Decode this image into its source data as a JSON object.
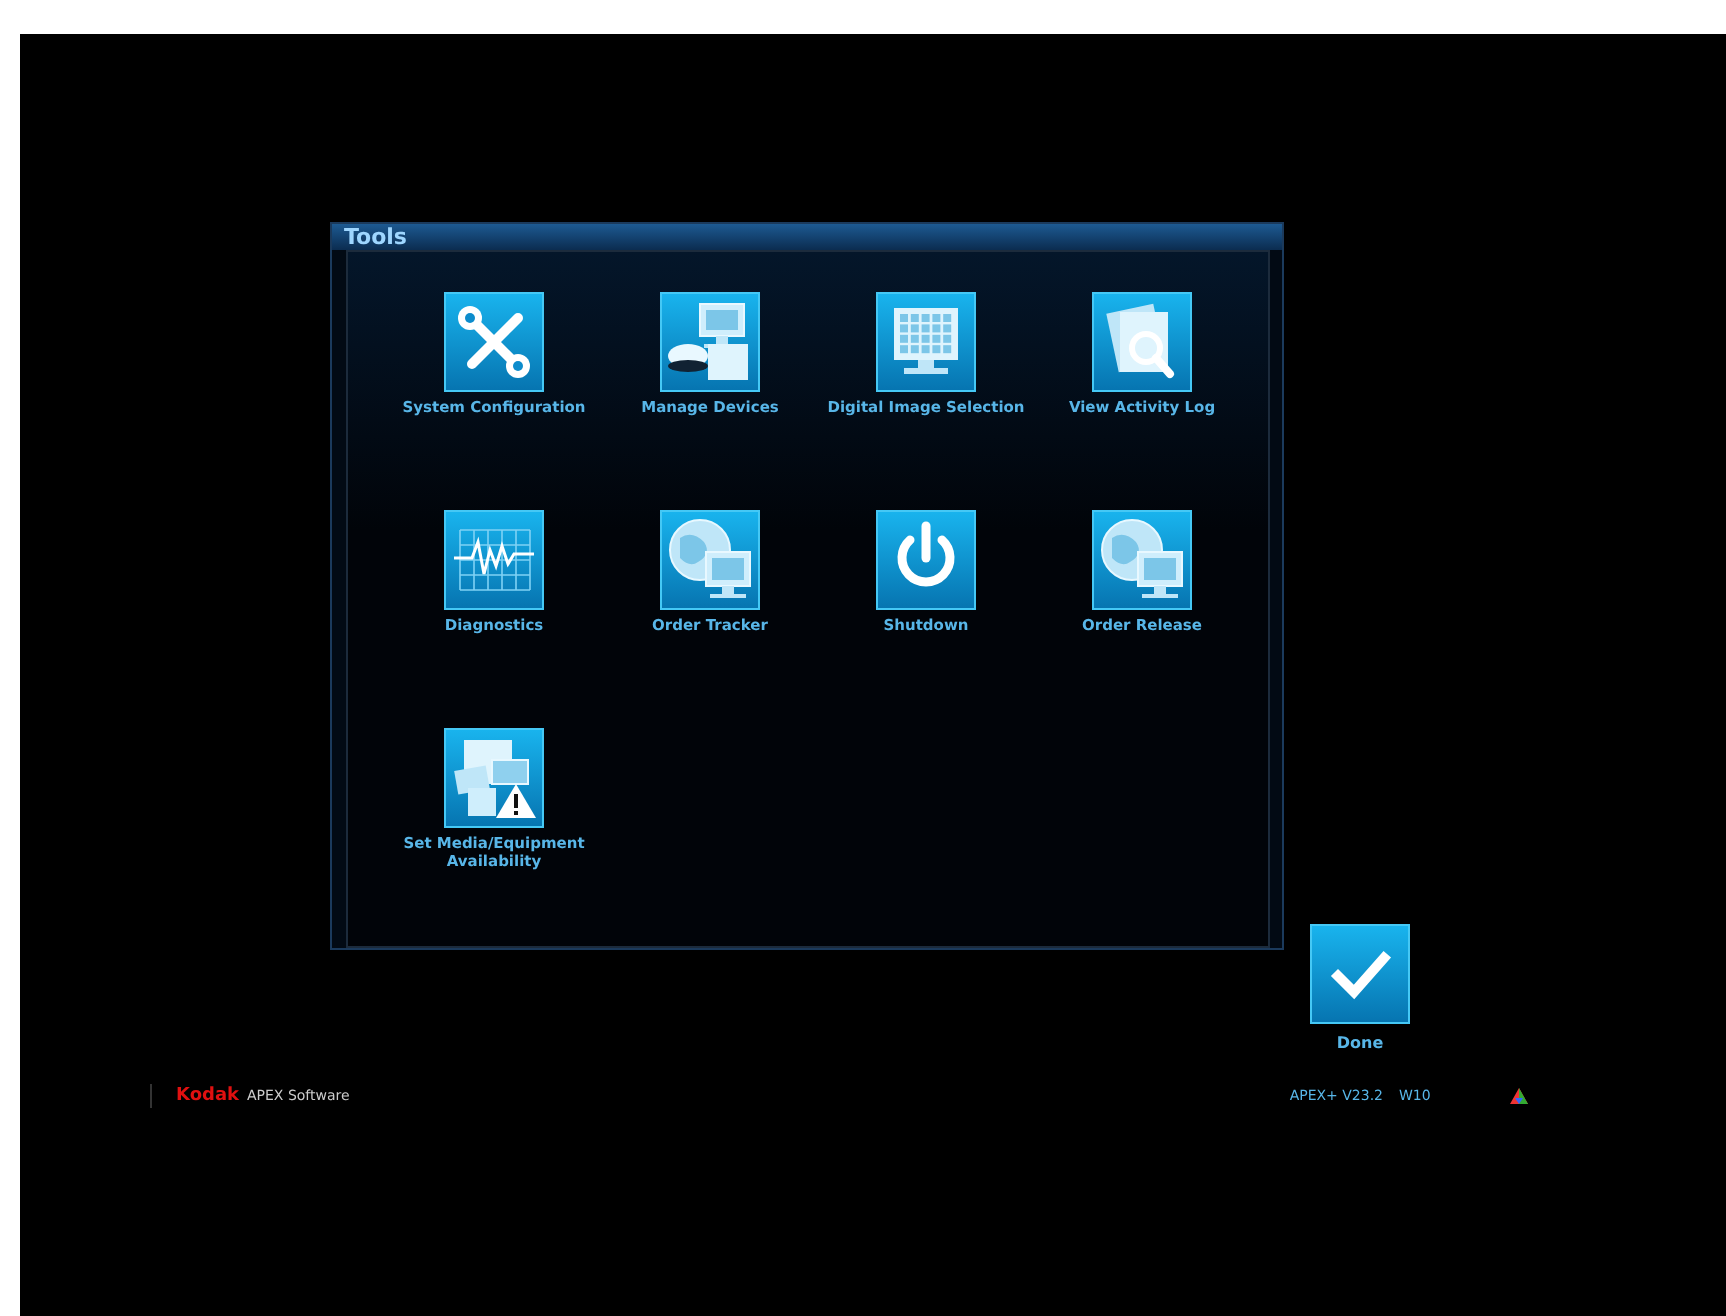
{
  "dialog": {
    "title": "Tools"
  },
  "tools": [
    {
      "label": "System Configuration",
      "kind": "wrench"
    },
    {
      "label": "Manage Devices",
      "kind": "devices"
    },
    {
      "label": "Digital Image Selection",
      "kind": "image-grid"
    },
    {
      "label": "View Activity Log",
      "kind": "log"
    },
    {
      "label": "Diagnostics",
      "kind": "diagnostics"
    },
    {
      "label": "Order Tracker",
      "kind": "globe-monitor"
    },
    {
      "label": "Shutdown",
      "kind": "power"
    },
    {
      "label": "Order Release",
      "kind": "globe-monitor"
    },
    {
      "label": "Set Media/Equipment Availability",
      "kind": "media-warning"
    }
  ],
  "done_button": {
    "label": "Done"
  },
  "footer": {
    "brand": "Kodak",
    "product": "APEX Software",
    "version": "APEX+ V23.2",
    "build": "W10"
  }
}
